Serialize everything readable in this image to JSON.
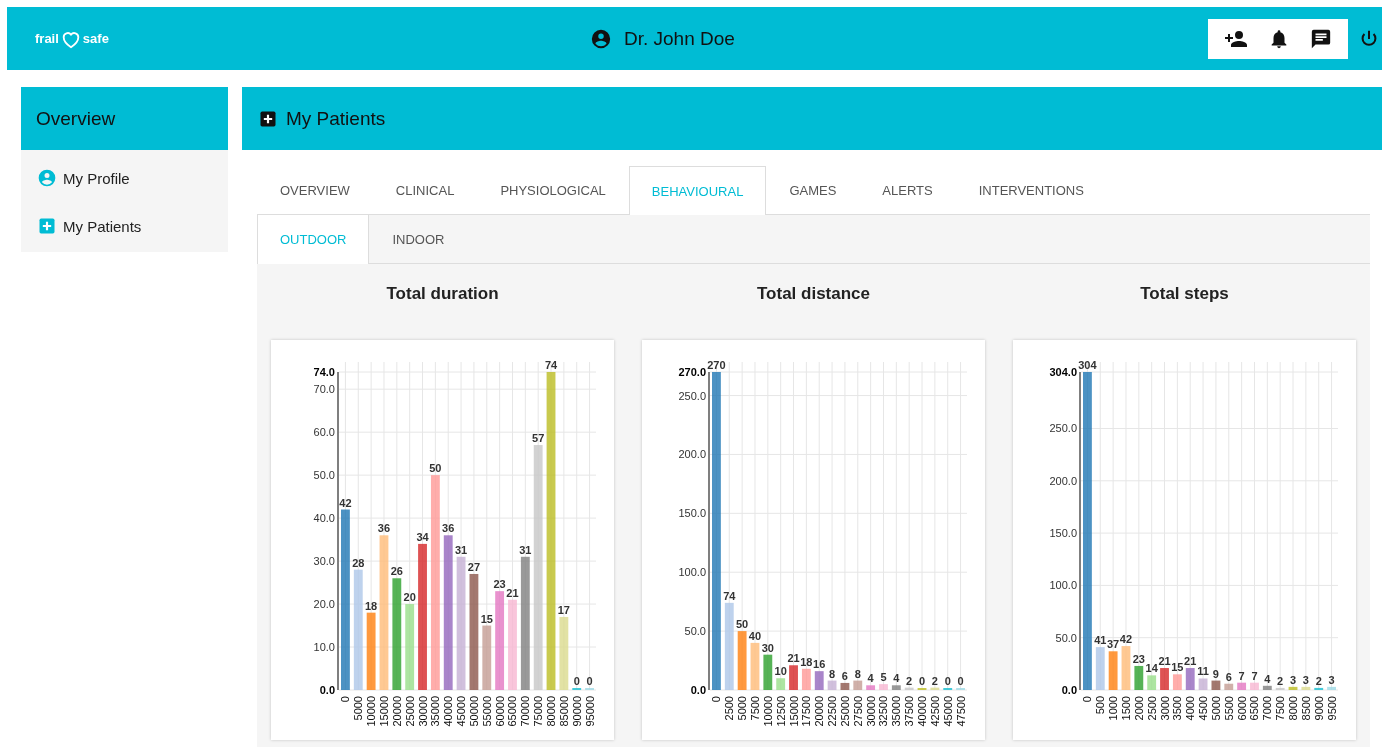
{
  "header": {
    "logo_left": "frail",
    "logo_right": "safe",
    "user": "Dr. John Doe"
  },
  "sidebar": {
    "title": "Overview",
    "items": [
      {
        "label": "My Profile",
        "kind": "profile",
        "selected": false
      },
      {
        "label": "My Patients",
        "kind": "patients",
        "selected": false
      }
    ]
  },
  "main": {
    "title": "My Patients",
    "tabs": [
      {
        "label": "OVERVIEW",
        "selected": false
      },
      {
        "label": "CLINICAL",
        "selected": false
      },
      {
        "label": "PHYSIOLOGICAL",
        "selected": false
      },
      {
        "label": "BEHAVIOURAL",
        "selected": true
      },
      {
        "label": "GAMES",
        "selected": false
      },
      {
        "label": "ALERTS",
        "selected": false
      },
      {
        "label": "INTERVENTIONS",
        "selected": false
      }
    ],
    "subtabs": [
      {
        "label": "OUTDOOR",
        "selected": true
      },
      {
        "label": "INDOOR",
        "selected": false
      }
    ],
    "charts": [
      {
        "title": "Total duration",
        "chart_data": {
          "type": "bar",
          "data_labels": true,
          "grid": true,
          "ylim": [
            0,
            74
          ],
          "categories": [
            "0",
            "5000",
            "10000",
            "15000",
            "20000",
            "25000",
            "30000",
            "35000",
            "40000",
            "45000",
            "50000",
            "55000",
            "60000",
            "65000",
            "70000",
            "75000",
            "80000",
            "85000",
            "90000",
            "95000"
          ],
          "values": [
            42,
            28,
            18,
            36,
            26,
            20,
            34,
            50,
            36,
            31,
            27,
            15,
            23,
            21,
            31,
            57,
            74,
            17,
            0,
            0
          ],
          "yticks": [
            {
              "value": 0,
              "label": "0.0"
            },
            {
              "value": 10,
              "label": "10.0"
            },
            {
              "value": 20,
              "label": "20.0"
            },
            {
              "value": 30,
              "label": "30.0"
            },
            {
              "value": 40,
              "label": "40.0"
            },
            {
              "value": 50,
              "label": "50.0"
            },
            {
              "value": 60,
              "label": "60.0"
            },
            {
              "value": 70,
              "label": "70.0"
            },
            {
              "value": 74,
              "label": "74.0"
            }
          ]
        }
      },
      {
        "title": "Total distance",
        "chart_data": {
          "type": "bar",
          "data_labels": true,
          "grid": true,
          "ylim": [
            0,
            270
          ],
          "categories": [
            "0",
            "2500",
            "5000",
            "7500",
            "10000",
            "12500",
            "15000",
            "17500",
            "20000",
            "22500",
            "25000",
            "27500",
            "30000",
            "32500",
            "35000",
            "37500",
            "40000",
            "42500",
            "45000",
            "47500"
          ],
          "values": [
            270,
            74,
            50,
            40,
            30,
            10,
            21,
            18,
            16,
            8,
            6,
            8,
            4,
            5,
            4,
            2,
            0,
            2,
            0,
            0
          ],
          "yticks": [
            {
              "value": 0,
              "label": "0.0"
            },
            {
              "value": 50,
              "label": "50.0"
            },
            {
              "value": 100,
              "label": "100.0"
            },
            {
              "value": 150,
              "label": "150.0"
            },
            {
              "value": 200,
              "label": "200.0"
            },
            {
              "value": 250,
              "label": "250.0"
            },
            {
              "value": 270,
              "label": "270.0"
            }
          ]
        }
      },
      {
        "title": "Total steps",
        "chart_data": {
          "type": "bar",
          "data_labels": true,
          "grid": true,
          "ylim": [
            0,
            304
          ],
          "categories": [
            "0",
            "500",
            "1000",
            "1500",
            "2000",
            "2500",
            "3000",
            "3500",
            "4000",
            "4500",
            "5000",
            "5500",
            "6000",
            "6500",
            "7000",
            "7500",
            "8000",
            "8500",
            "9000",
            "9500"
          ],
          "values": [
            304,
            41,
            37,
            42,
            23,
            14,
            21,
            15,
            21,
            11,
            9,
            6,
            7,
            7,
            4,
            2,
            3,
            3,
            2,
            3
          ],
          "yticks": [
            {
              "value": 0,
              "label": "0.0"
            },
            {
              "value": 50,
              "label": "50.0"
            },
            {
              "value": 100,
              "label": "100.0"
            },
            {
              "value": 150,
              "label": "150.0"
            },
            {
              "value": 200,
              "label": "200.0"
            },
            {
              "value": 250,
              "label": "250.0"
            },
            {
              "value": 304,
              "label": "304.0"
            }
          ]
        }
      }
    ]
  }
}
